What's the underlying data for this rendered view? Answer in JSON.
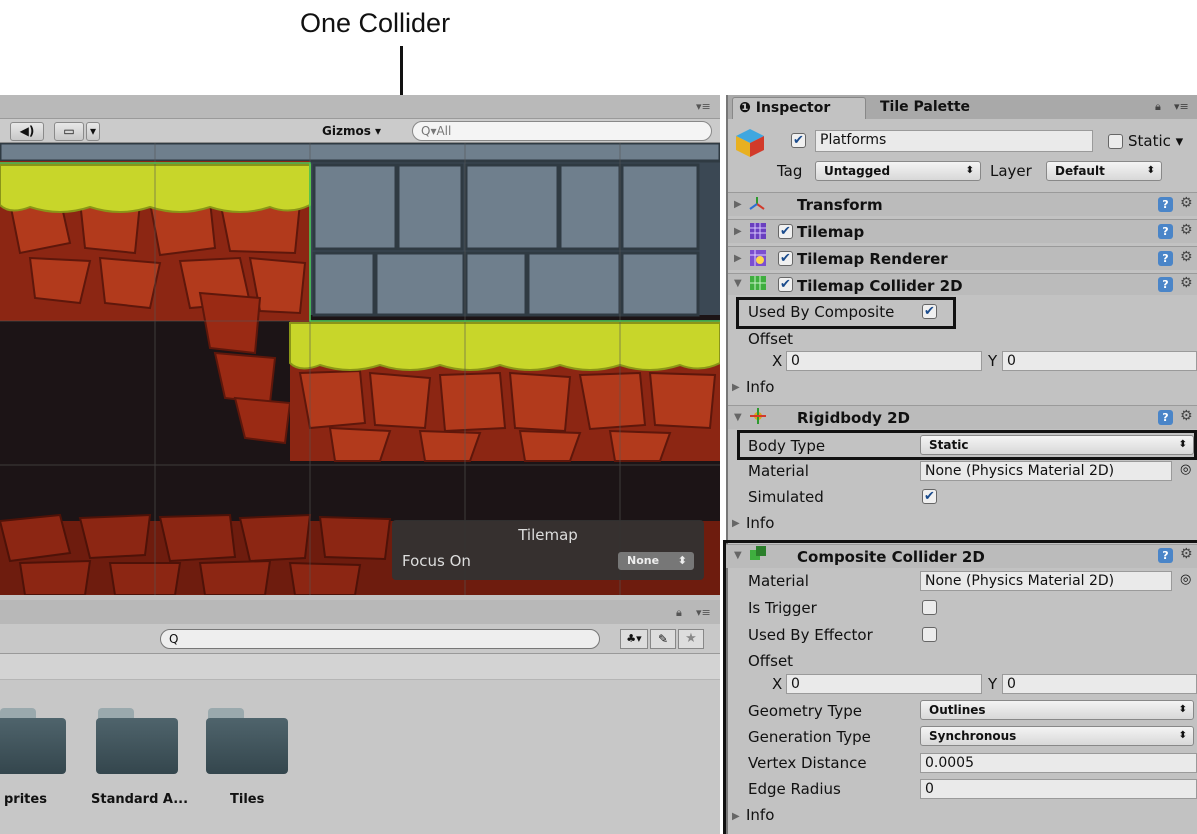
{
  "annotation": {
    "callout": "One Collider"
  },
  "scene": {
    "toolbar": {
      "audio_icon": "speaker-icon",
      "image_icon": "image-icon",
      "gizmos_label": "Gizmos",
      "search_placeholder": "All"
    },
    "overlay": {
      "title": "Tilemap",
      "focus_label": "Focus On",
      "focus_value": "None"
    }
  },
  "project": {
    "folders": [
      {
        "label": "prites"
      },
      {
        "label": "Standard A..."
      },
      {
        "label": "Tiles"
      }
    ]
  },
  "inspector": {
    "tabs": [
      {
        "label": "Inspector"
      },
      {
        "label": "Tile Palette"
      }
    ],
    "object": {
      "name": "Platforms",
      "active": true,
      "static_label": "Static",
      "tag_label": "Tag",
      "tag_value": "Untagged",
      "layer_label": "Layer",
      "layer_value": "Default"
    },
    "components": {
      "transform": {
        "title": "Transform"
      },
      "tilemap": {
        "title": "Tilemap"
      },
      "tilemap_renderer": {
        "title": "Tilemap Renderer"
      },
      "tilemap_collider": {
        "title": "Tilemap Collider 2D",
        "used_by_composite_label": "Used By Composite",
        "used_by_composite": true,
        "offset_label": "Offset",
        "x_label": "X",
        "x_value": "0",
        "y_label": "Y",
        "y_value": "0",
        "info_label": "Info"
      },
      "rigidbody": {
        "title": "Rigidbody 2D",
        "body_type_label": "Body Type",
        "body_type_value": "Static",
        "material_label": "Material",
        "material_value": "None (Physics Material 2D)",
        "simulated_label": "Simulated",
        "simulated": true,
        "info_label": "Info"
      },
      "composite": {
        "title": "Composite Collider 2D",
        "material_label": "Material",
        "material_value": "None (Physics Material 2D)",
        "is_trigger_label": "Is Trigger",
        "used_by_effector_label": "Used By Effector",
        "offset_label": "Offset",
        "x_label": "X",
        "x_value": "0",
        "y_label": "Y",
        "y_value": "0",
        "geometry_type_label": "Geometry Type",
        "geometry_type_value": "Outlines",
        "generation_type_label": "Generation Type",
        "generation_type_value": "Synchronous",
        "vertex_distance_label": "Vertex Distance",
        "vertex_distance_value": "0.0005",
        "edge_radius_label": "Edge Radius",
        "edge_radius_value": "0",
        "info_label": "Info"
      }
    }
  },
  "colors": {
    "grass": "#c8d62a",
    "rock": "#9a2a14",
    "stone": "#6f7f8d",
    "highlight": "#111111"
  }
}
